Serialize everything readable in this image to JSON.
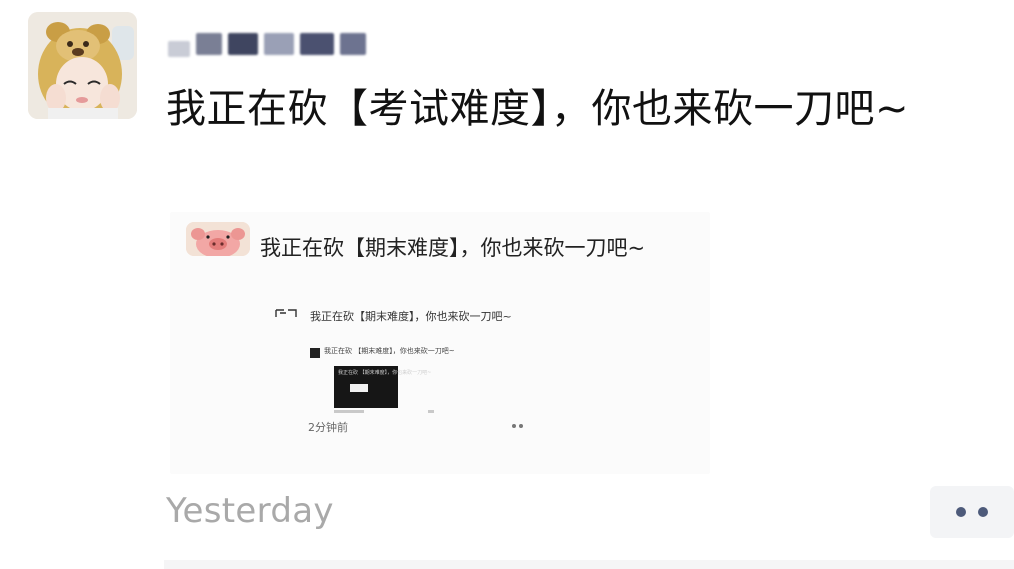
{
  "post": {
    "author_name": "",
    "text": "我正在砍【考试难度】，你也来砍一刀吧~",
    "time": "Yesterday"
  },
  "embedded_screenshot": {
    "text": "我正在砍【期末难度】，你也来砍一刀吧~",
    "nested": {
      "text": "我正在砍【期末难度】，你也来砍一刀吧~",
      "time": "2分钟前",
      "nested": {
        "text": "我正在砍 【期末难度】，你也来砍一刀吧~"
      }
    }
  },
  "actions": {
    "more_icon": "more-dots-icon"
  },
  "colors": {
    "time_gray": "#a9a9a9",
    "more_dots": "#4d5a7a",
    "more_bg": "#f3f4f6"
  }
}
